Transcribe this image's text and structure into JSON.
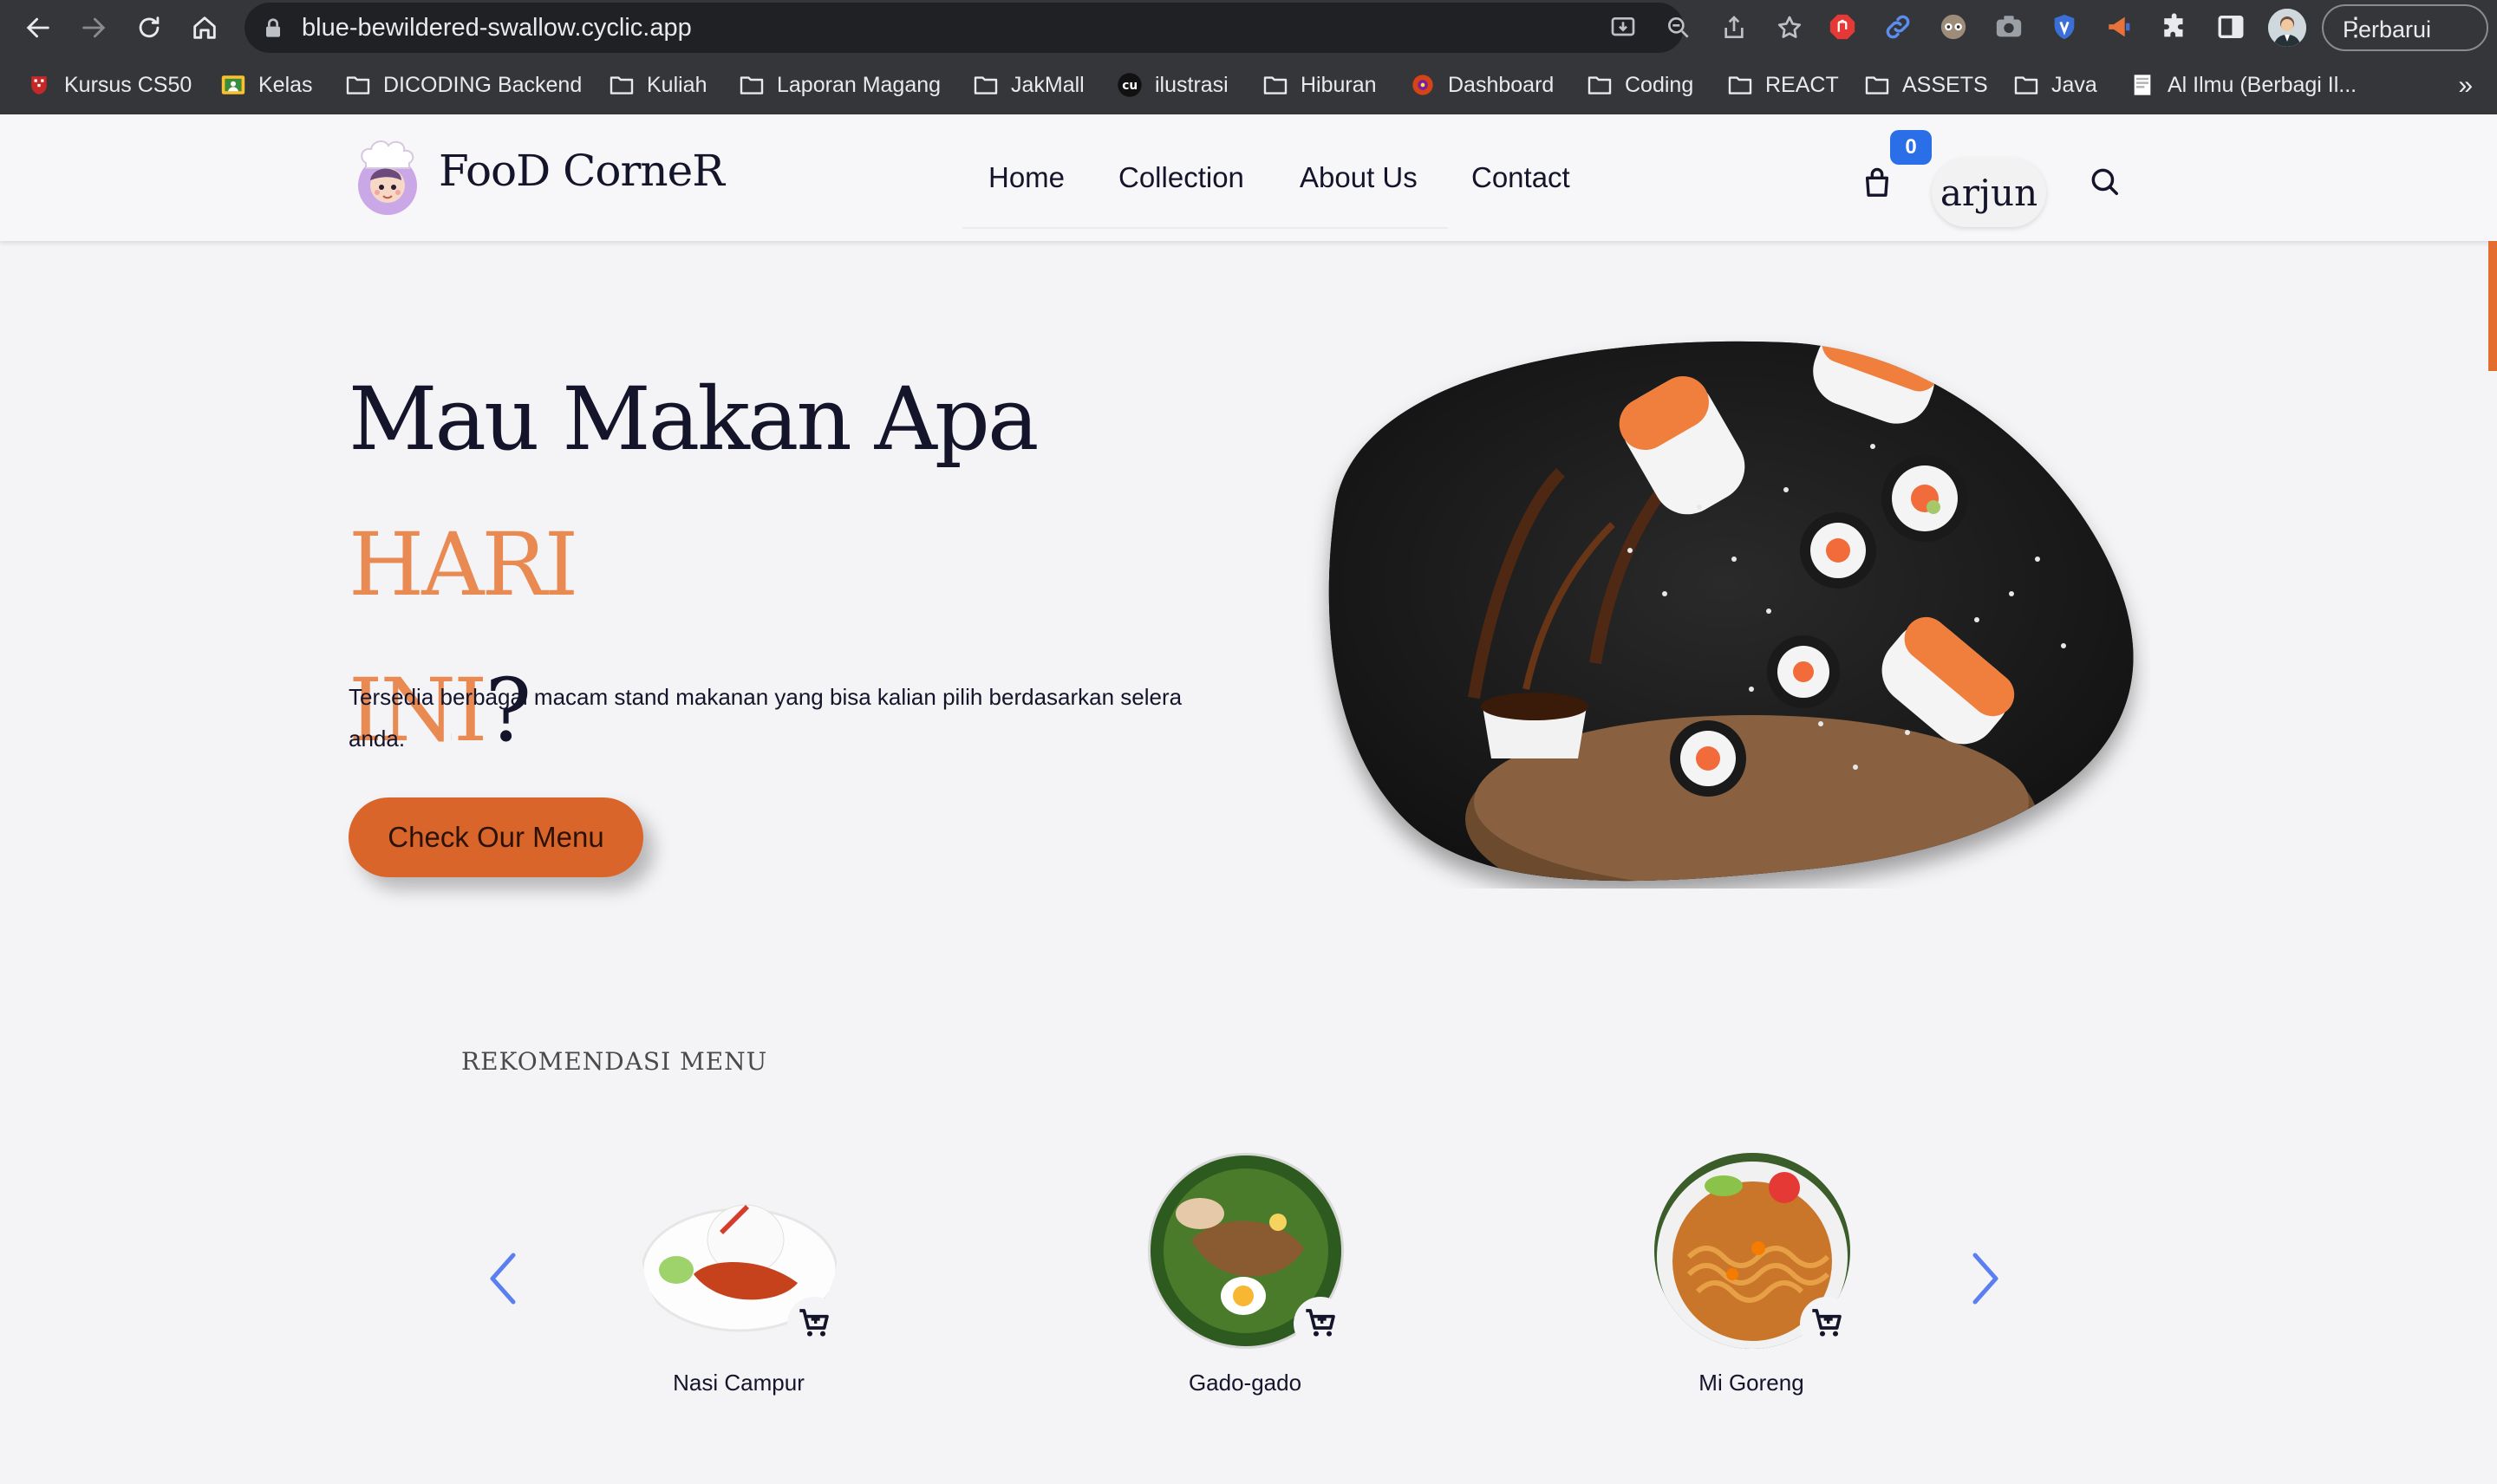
{
  "browser": {
    "url": "blue-bewildered-swallow.cyclic.app",
    "update_label": "Perbarui",
    "bookmarks": [
      {
        "label": "Kursus CS50",
        "icon": "harvard-shield-icon"
      },
      {
        "label": "Kelas",
        "icon": "classroom-icon"
      },
      {
        "label": "DICODING Backend",
        "icon": "folder-icon"
      },
      {
        "label": "Kuliah",
        "icon": "folder-icon"
      },
      {
        "label": "Laporan Magang",
        "icon": "folder-icon"
      },
      {
        "label": "JakMall",
        "icon": "folder-icon"
      },
      {
        "label": "ilustrasi",
        "icon": "illustration-logo-icon"
      },
      {
        "label": "Hiburan",
        "icon": "folder-icon"
      },
      {
        "label": "Dashboard",
        "icon": "dashboard-logo-icon"
      },
      {
        "label": "Coding",
        "icon": "folder-icon"
      },
      {
        "label": "REACT",
        "icon": "folder-icon"
      },
      {
        "label": "ASSETS",
        "icon": "folder-icon"
      },
      {
        "label": "Java",
        "icon": "folder-icon"
      },
      {
        "label": "Al Ilmu (Berbagi Il...",
        "icon": "page-icon"
      }
    ],
    "more_label": "»"
  },
  "header": {
    "brand": "FooD CorneR",
    "nav": [
      "Home",
      "Collection",
      "About Us",
      "Contact"
    ],
    "cart_count": "0",
    "username": "arjun"
  },
  "hero": {
    "title_part1": "Mau Makan Apa ",
    "title_accent1": "HARI",
    "title_accent2": "INI",
    "title_end": "?",
    "description": "Tersedia berbagai macam stand makanan yang bisa kalian pilih berdasarkan selera anda.",
    "cta_label": "Check Our Menu"
  },
  "recommendations": {
    "heading": "REKOMENDASI MENU",
    "items": [
      {
        "name": "Nasi Campur"
      },
      {
        "name": "Gado-gado"
      },
      {
        "name": "Mi Goreng"
      }
    ]
  },
  "colors": {
    "accent": "#e88a52",
    "cta": "#d9652b",
    "badge": "#2a6ee8",
    "text": "#14142b"
  }
}
